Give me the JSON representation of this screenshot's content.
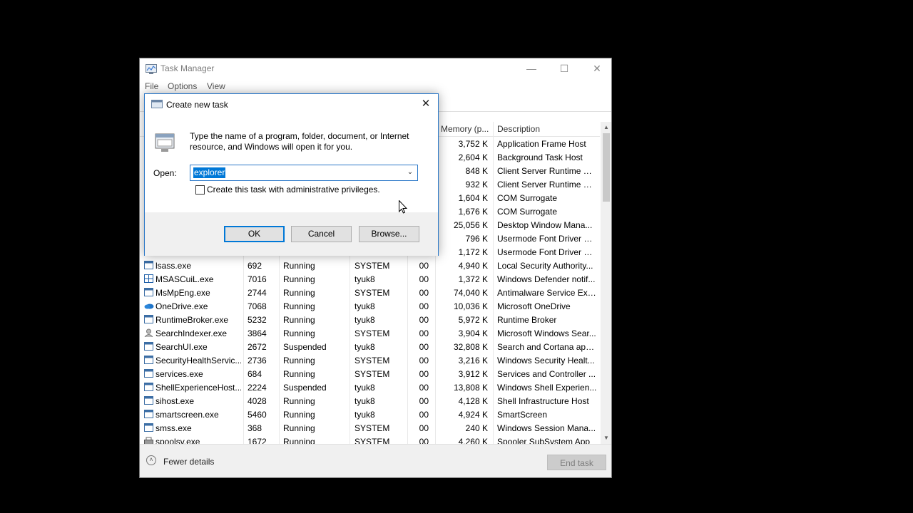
{
  "task_manager": {
    "title": "Task Manager",
    "menu": [
      "File",
      "Options",
      "View"
    ],
    "columns": {
      "memory": "Memory (p...",
      "description": "Description"
    },
    "partial_rows": [
      {
        "memory": "3,752 K",
        "description": "Application Frame Host"
      },
      {
        "memory": "2,604 K",
        "description": "Background Task Host"
      },
      {
        "memory": "848 K",
        "description": "Client Server Runtime Pr..."
      },
      {
        "memory": "932 K",
        "description": "Client Server Runtime Pr..."
      },
      {
        "memory": "1,604 K",
        "description": "COM Surrogate"
      },
      {
        "memory": "1,676 K",
        "description": "COM Surrogate"
      },
      {
        "memory": "25,056 K",
        "description": "Desktop Window Mana..."
      },
      {
        "memory": "796 K",
        "description": "Usermode Font Driver H..."
      },
      {
        "memory": "1,172 K",
        "description": "Usermode Font Driver H..."
      }
    ],
    "rows": [
      {
        "name": "lsass.exe",
        "pid": "692",
        "status": "Running",
        "user": "SYSTEM",
        "cpu": "00",
        "memory": "4,940 K",
        "description": "Local Security Authority..."
      },
      {
        "name": "MSASCuiL.exe",
        "pid": "7016",
        "status": "Running",
        "user": "tyuk8",
        "cpu": "00",
        "memory": "1,372 K",
        "description": "Windows Defender notif..."
      },
      {
        "name": "MsMpEng.exe",
        "pid": "2744",
        "status": "Running",
        "user": "SYSTEM",
        "cpu": "00",
        "memory": "74,040 K",
        "description": "Antimalware Service Exe..."
      },
      {
        "name": "OneDrive.exe",
        "pid": "7068",
        "status": "Running",
        "user": "tyuk8",
        "cpu": "00",
        "memory": "10,036 K",
        "description": "Microsoft OneDrive"
      },
      {
        "name": "RuntimeBroker.exe",
        "pid": "5232",
        "status": "Running",
        "user": "tyuk8",
        "cpu": "00",
        "memory": "5,972 K",
        "description": "Runtime Broker"
      },
      {
        "name": "SearchIndexer.exe",
        "pid": "3864",
        "status": "Running",
        "user": "SYSTEM",
        "cpu": "00",
        "memory": "3,904 K",
        "description": "Microsoft Windows Sear..."
      },
      {
        "name": "SearchUI.exe",
        "pid": "2672",
        "status": "Suspended",
        "user": "tyuk8",
        "cpu": "00",
        "memory": "32,808 K",
        "description": "Search and Cortana app..."
      },
      {
        "name": "SecurityHealthServic...",
        "pid": "2736",
        "status": "Running",
        "user": "SYSTEM",
        "cpu": "00",
        "memory": "3,216 K",
        "description": "Windows Security Healt..."
      },
      {
        "name": "services.exe",
        "pid": "684",
        "status": "Running",
        "user": "SYSTEM",
        "cpu": "00",
        "memory": "3,912 K",
        "description": "Services and Controller ..."
      },
      {
        "name": "ShellExperienceHost....",
        "pid": "2224",
        "status": "Suspended",
        "user": "tyuk8",
        "cpu": "00",
        "memory": "13,808 K",
        "description": "Windows Shell Experien..."
      },
      {
        "name": "sihost.exe",
        "pid": "4028",
        "status": "Running",
        "user": "tyuk8",
        "cpu": "00",
        "memory": "4,128 K",
        "description": "Shell Infrastructure Host"
      },
      {
        "name": "smartscreen.exe",
        "pid": "5460",
        "status": "Running",
        "user": "tyuk8",
        "cpu": "00",
        "memory": "4,924 K",
        "description": "SmartScreen"
      },
      {
        "name": "smss.exe",
        "pid": "368",
        "status": "Running",
        "user": "SYSTEM",
        "cpu": "00",
        "memory": "240 K",
        "description": "Windows Session Mana..."
      },
      {
        "name": "spoolsv.exe",
        "pid": "1672",
        "status": "Running",
        "user": "SYSTEM",
        "cpu": "00",
        "memory": "4,260 K",
        "description": "Spooler SubSystem App"
      }
    ],
    "fewer_details": "Fewer details",
    "end_task": "End task"
  },
  "dialog": {
    "title": "Create new task",
    "description": "Type the name of a program, folder, document, or Internet resource, and Windows will open it for you.",
    "open_label": "Open:",
    "open_value": "explorer",
    "admin_checkbox_label": "Create this task with administrative privileges.",
    "admin_checked": false,
    "ok": "OK",
    "cancel": "Cancel",
    "browse": "Browse..."
  },
  "colors": {
    "accent": "#0078d7",
    "dialog_border": "#2b78c8"
  }
}
